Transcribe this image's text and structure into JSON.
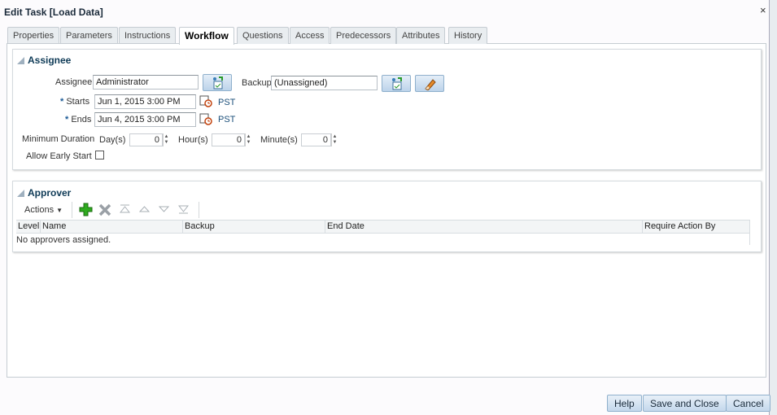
{
  "dialog": {
    "title": "Edit Task [Load Data]",
    "close_glyph": "×"
  },
  "tabs": [
    {
      "label": "Properties"
    },
    {
      "label": "Parameters"
    },
    {
      "label": "Instructions"
    },
    {
      "label": "Workflow",
      "active": true
    },
    {
      "label": "Questions"
    },
    {
      "label": "Access"
    },
    {
      "label": "Predecessors"
    },
    {
      "label": "Attributes"
    },
    {
      "label": "History"
    }
  ],
  "assignee_section": {
    "title": "Assignee",
    "assignee_label": "Assignee",
    "assignee_value": "Administrator",
    "backup_label": "Backup",
    "backup_value": "(Unassigned)",
    "required_mark": "*",
    "starts_label": "Starts",
    "starts_value": "Jun 1, 2015 3:00 PM",
    "starts_tz": "PST",
    "ends_label": "Ends",
    "ends_value": "Jun 4, 2015 3:00 PM",
    "ends_tz": "PST",
    "min_duration_label": "Minimum Duration",
    "days_label": "Day(s)",
    "days_value": "0",
    "hours_label": "Hour(s)",
    "hours_value": "0",
    "minutes_label": "Minute(s)",
    "minutes_value": "0",
    "allow_early_start_label": "Allow Early Start",
    "allow_early_start_checked": false
  },
  "approver_section": {
    "title": "Approver",
    "actions_label": "Actions",
    "columns": [
      "Level",
      "Name",
      "Backup",
      "End Date",
      "Require Action By"
    ],
    "empty_text": "No approvers assigned."
  },
  "footer": {
    "help": "Help",
    "save_close": "Save and Close",
    "cancel": "Cancel"
  },
  "colors": {
    "accent": "#0f3b57",
    "button_top": "#e8f0f8",
    "button_bottom": "#c4d8ec",
    "add_icon": "#2eaa1e"
  }
}
